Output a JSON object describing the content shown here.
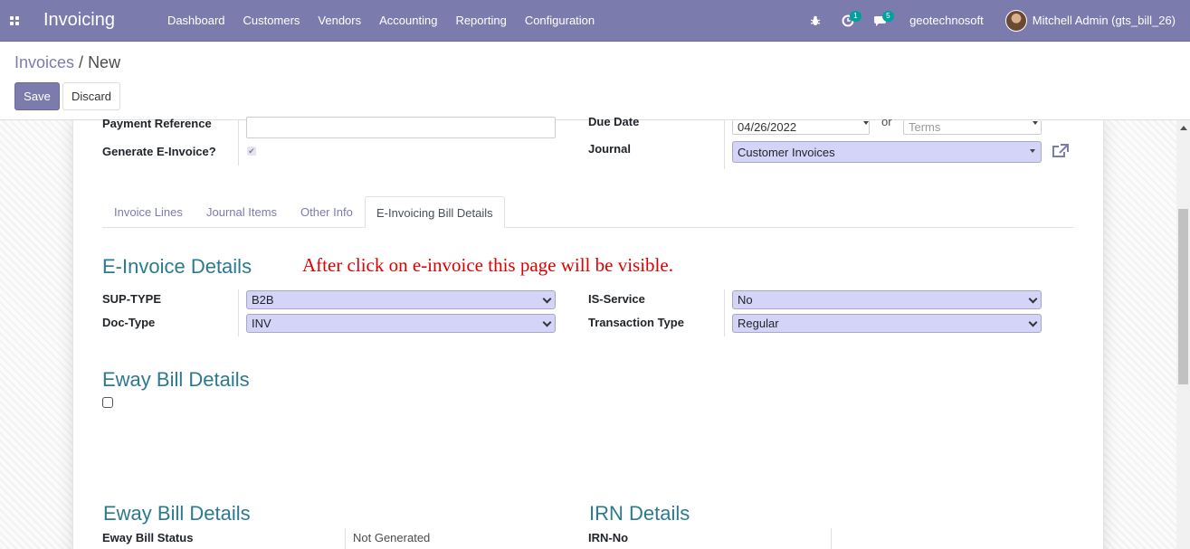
{
  "navbar": {
    "apps_icon": "apps-grid-icon",
    "brand": "Invoicing",
    "menu": [
      "Dashboard",
      "Customers",
      "Vendors",
      "Accounting",
      "Reporting",
      "Configuration"
    ],
    "activity_count": "1",
    "message_count": "5",
    "company": "geotechnosoft",
    "user": "Mitchell Admin (gts_bill_26)"
  },
  "breadcrumb": {
    "parent": "Invoices",
    "separator": " / ",
    "current": "New"
  },
  "buttons": {
    "save": "Save",
    "discard": "Discard"
  },
  "form": {
    "payment_reference_label": "Payment Reference",
    "payment_reference_value": "",
    "generate_einvoice_label": "Generate E-Invoice?",
    "due_date_label": "Due Date",
    "due_date_value": "04/26/2022",
    "or_text": "or",
    "terms_placeholder": "Terms",
    "journal_label": "Journal",
    "journal_value": "Customer Invoices"
  },
  "tabs": [
    "Invoice Lines",
    "Journal Items",
    "Other Info",
    "E-Invoicing Bill Details"
  ],
  "einvoice": {
    "title": "E-Invoice Details",
    "annotation": "After click on e-invoice this page will be visible.",
    "sup_type_label": "SUP-TYPE",
    "sup_type_value": "B2B",
    "doc_type_label": "Doc-Type",
    "doc_type_value": "INV",
    "is_service_label": "IS-Service",
    "is_service_value": "No",
    "transaction_type_label": "Transaction Type",
    "transaction_type_value": "Regular"
  },
  "eway": {
    "title": "Eway Bill Details",
    "details_title": "Eway Bill Details",
    "status_label": "Eway Bill Status",
    "status_value": "Not Generated"
  },
  "irn": {
    "title": "IRN Details",
    "irn_no_label": "IRN-No"
  },
  "colors": {
    "navbar": "#7c7bad",
    "section_title": "#2c7a90",
    "annotation": "#e00000",
    "select_bg": "#d4d3f8"
  }
}
